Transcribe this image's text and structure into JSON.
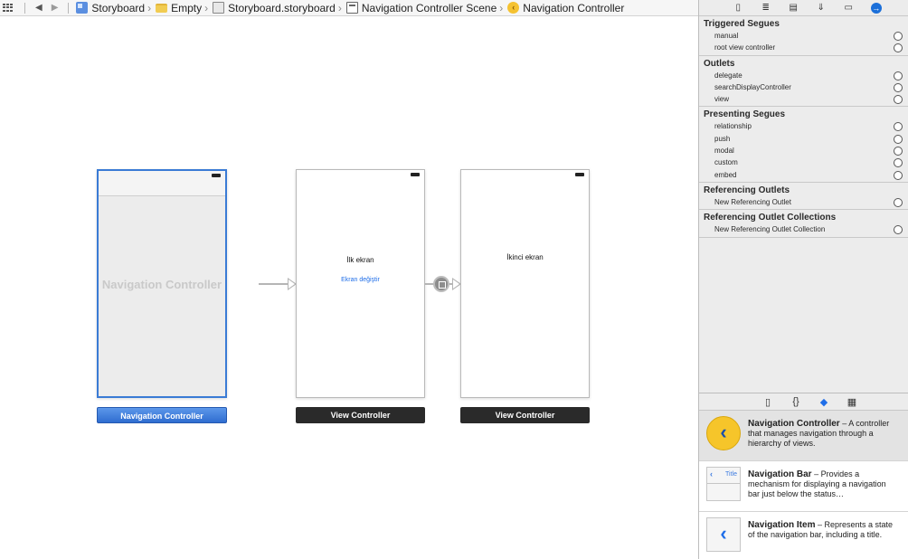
{
  "jumpbar": {
    "crumbs": [
      "Storyboard",
      "Empty",
      "Storyboard.storyboard",
      "Navigation Controller Scene",
      "Navigation Controller"
    ]
  },
  "canvas": {
    "nav_controller": {
      "watermark": "Navigation Controller",
      "dock_label": "Navigation Controller"
    },
    "view_controller_1": {
      "title": "İlk ekran",
      "button": "Ekran değiştir",
      "dock_label": "View Controller"
    },
    "view_controller_2": {
      "title": "İkinci ekran",
      "dock_label": "View Controller"
    }
  },
  "inspector": {
    "tabs": [
      "file-icon",
      "quick-help-icon",
      "identity-icon",
      "attributes-icon",
      "size-icon",
      "connections-icon"
    ],
    "sections": [
      {
        "title": "Triggered Segues",
        "rows": [
          "manual",
          "root view controller"
        ]
      },
      {
        "title": "Outlets",
        "rows": [
          "delegate",
          "searchDisplayController",
          "view"
        ]
      },
      {
        "title": "Presenting Segues",
        "rows": [
          "relationship",
          "push",
          "modal",
          "custom",
          "embed"
        ]
      },
      {
        "title": "Referencing Outlets",
        "rows": [
          "New Referencing Outlet"
        ]
      },
      {
        "title": "Referencing Outlet Collections",
        "rows": [
          "New Referencing Outlet Collection"
        ]
      }
    ]
  },
  "library": {
    "tabs": [
      "file-template-icon",
      "code-snippet-icon",
      "object-library-icon",
      "media-library-icon"
    ],
    "items": [
      {
        "name": "Navigation Controller",
        "desc": " – A controller that manages navigation through a hierarchy of views."
      },
      {
        "name": "Navigation Bar",
        "desc": " – Provides a mechanism for displaying a navigation bar just below the status…",
        "thumb_title": "Title"
      },
      {
        "name": "Navigation Item",
        "desc": " – Represents a state of the navigation bar, including a title."
      }
    ]
  },
  "colors": {
    "selection_blue": "#3a7bd5",
    "segue_gray": "#b5b5b5",
    "accent_yellow": "#f6c52a"
  }
}
